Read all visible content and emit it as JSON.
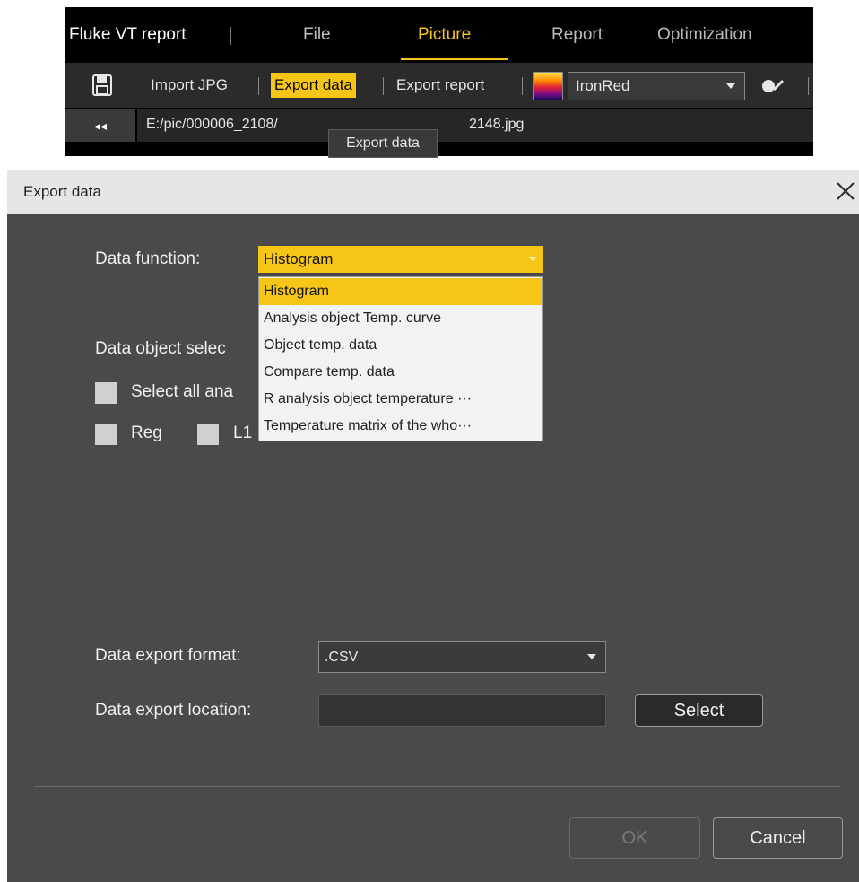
{
  "app": {
    "title": "Fluke VT report",
    "menu": [
      {
        "label": "File",
        "active": false
      },
      {
        "label": "Picture",
        "active": true
      },
      {
        "label": "Report",
        "active": false
      },
      {
        "label": "Optimization",
        "active": false
      }
    ],
    "toolbar": {
      "save_icon": "save-icon",
      "import_jpg": "Import JPG",
      "export_data": "Export data",
      "export_report": "Export report",
      "palette_value": "IronRed",
      "tool_icon": "color-picker-icon"
    },
    "pathbar": {
      "collapse_glyph": "◂◂",
      "path_left": "E:/pic/000006_2108/",
      "path_right": "2148.jpg",
      "tooltip": "Export data"
    },
    "accent_color": "#f5c518"
  },
  "dialog": {
    "title": "Export data",
    "close_icon": "close-icon",
    "data_function_label": "Data function:",
    "data_function_value": "Histogram",
    "dropdown_options": [
      "Histogram",
      "Analysis object Temp. curve",
      "Object temp. data",
      "Compare temp. data",
      "R analysis object temperature ···",
      "Temperature matrix of the who···"
    ],
    "selected_option": "Histogram",
    "data_object_label": "Data object selec",
    "select_all_label": "Select all ana",
    "objects": [
      {
        "label": "Reg",
        "checked": false
      },
      {
        "label": "L1",
        "checked": false
      }
    ],
    "export_format_label": "Data export format:",
    "export_format_value": ".CSV",
    "export_location_label": "Data export location:",
    "export_location_value": "",
    "select_button": "Select",
    "ok_button": "OK",
    "cancel_button": "Cancel"
  }
}
